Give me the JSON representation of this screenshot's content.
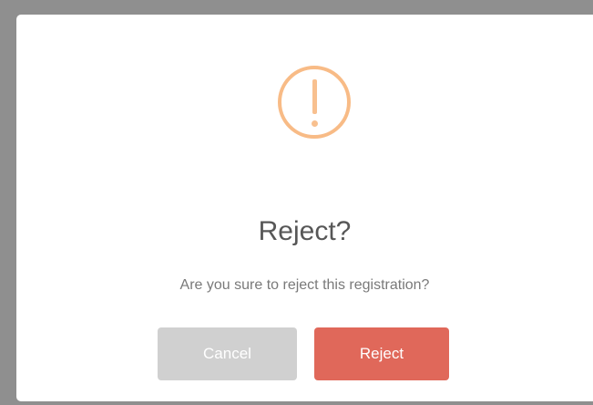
{
  "dialog": {
    "icon": "warning-exclamation-icon",
    "title": "Reject?",
    "message": "Are you sure to reject this registration?",
    "cancel_label": "Cancel",
    "confirm_label": "Reject"
  },
  "colors": {
    "icon": "#f8bb86",
    "confirm": "#e0685a",
    "cancel": "#d0d0d0"
  }
}
